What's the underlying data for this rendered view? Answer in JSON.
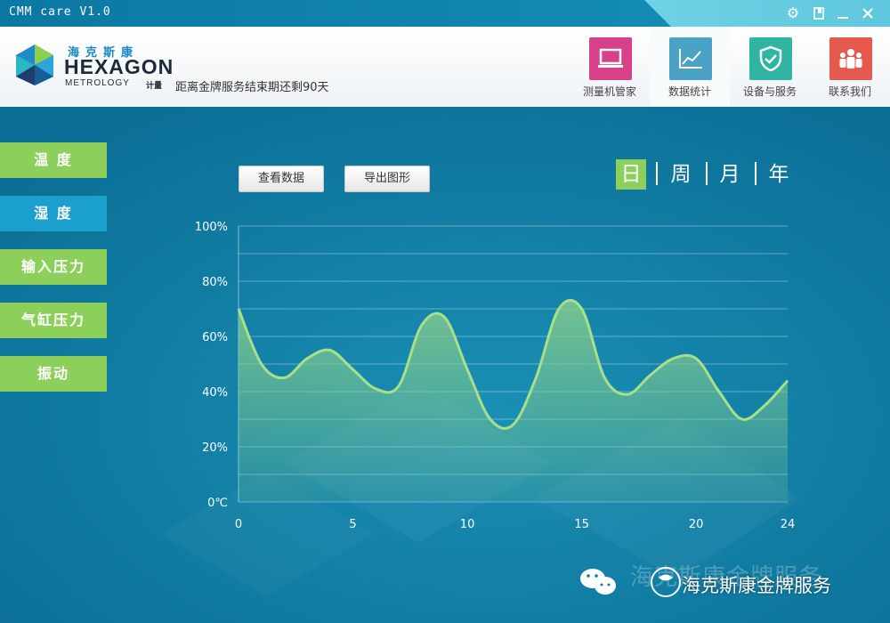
{
  "window": {
    "title": "CMM care  V1.0",
    "controls": [
      "gear-icon",
      "pin-icon",
      "minimize-icon",
      "close-icon"
    ]
  },
  "brand": {
    "chinese": "海克斯康",
    "name": "HEXAGON",
    "sub": "METROLOGY",
    "sub_cn": "计量"
  },
  "service_notice": "距离金牌服务结束期还剩90天",
  "nav": [
    {
      "label": "测量机管家",
      "icon": "laptop-icon",
      "color": "#d9408a"
    },
    {
      "label": "数据统计",
      "icon": "line-chart-icon",
      "color": "#4aa3c7",
      "active": true
    },
    {
      "label": "设备与服务",
      "icon": "shield-check-icon",
      "color": "#2fb5a2"
    },
    {
      "label": "联系我们",
      "icon": "people-icon",
      "color": "#e55a4d"
    }
  ],
  "sidebar": [
    {
      "label": "温 度",
      "active": false
    },
    {
      "label": "湿 度",
      "active": true
    },
    {
      "label": "输入压力",
      "active": false
    },
    {
      "label": "气缸压力",
      "active": false
    },
    {
      "label": "振动",
      "active": false
    }
  ],
  "toolbar": {
    "view_data": "查看数据",
    "export_chart": "导出图形"
  },
  "periods": [
    {
      "label": "日",
      "active": true
    },
    {
      "label": "周",
      "active": false
    },
    {
      "label": "月",
      "active": false
    },
    {
      "label": "年",
      "active": false
    }
  ],
  "chart_data": {
    "type": "area",
    "x": [
      0,
      1,
      2,
      3,
      4,
      5,
      6,
      7,
      8,
      9,
      10,
      11,
      12,
      13,
      14,
      15,
      16,
      17,
      18,
      19,
      20,
      21,
      22,
      23,
      24
    ],
    "values": [
      70,
      50,
      45,
      52,
      55,
      48,
      41,
      42,
      64,
      67,
      48,
      30,
      28,
      45,
      70,
      70,
      45,
      39,
      46,
      52,
      52,
      40,
      30,
      35,
      44
    ],
    "y_tick_labels": [
      "0℃",
      "",
      "20%",
      "",
      "40%",
      "",
      "60%",
      "",
      "80%",
      "",
      "100%"
    ],
    "x_tick_labels": [
      "0",
      "5",
      "10",
      "15",
      "20",
      "24"
    ],
    "x_tick_values": [
      0,
      5,
      10,
      15,
      20,
      24
    ],
    "ylim": [
      0,
      100
    ],
    "xlim": [
      0,
      24
    ],
    "grid": true,
    "line_color": "#a8e08a",
    "fill_color": "#7ec98e"
  },
  "watermark": {
    "text": "海克斯康金牌服务",
    "text_bg": "海克斯康金牌服务"
  }
}
